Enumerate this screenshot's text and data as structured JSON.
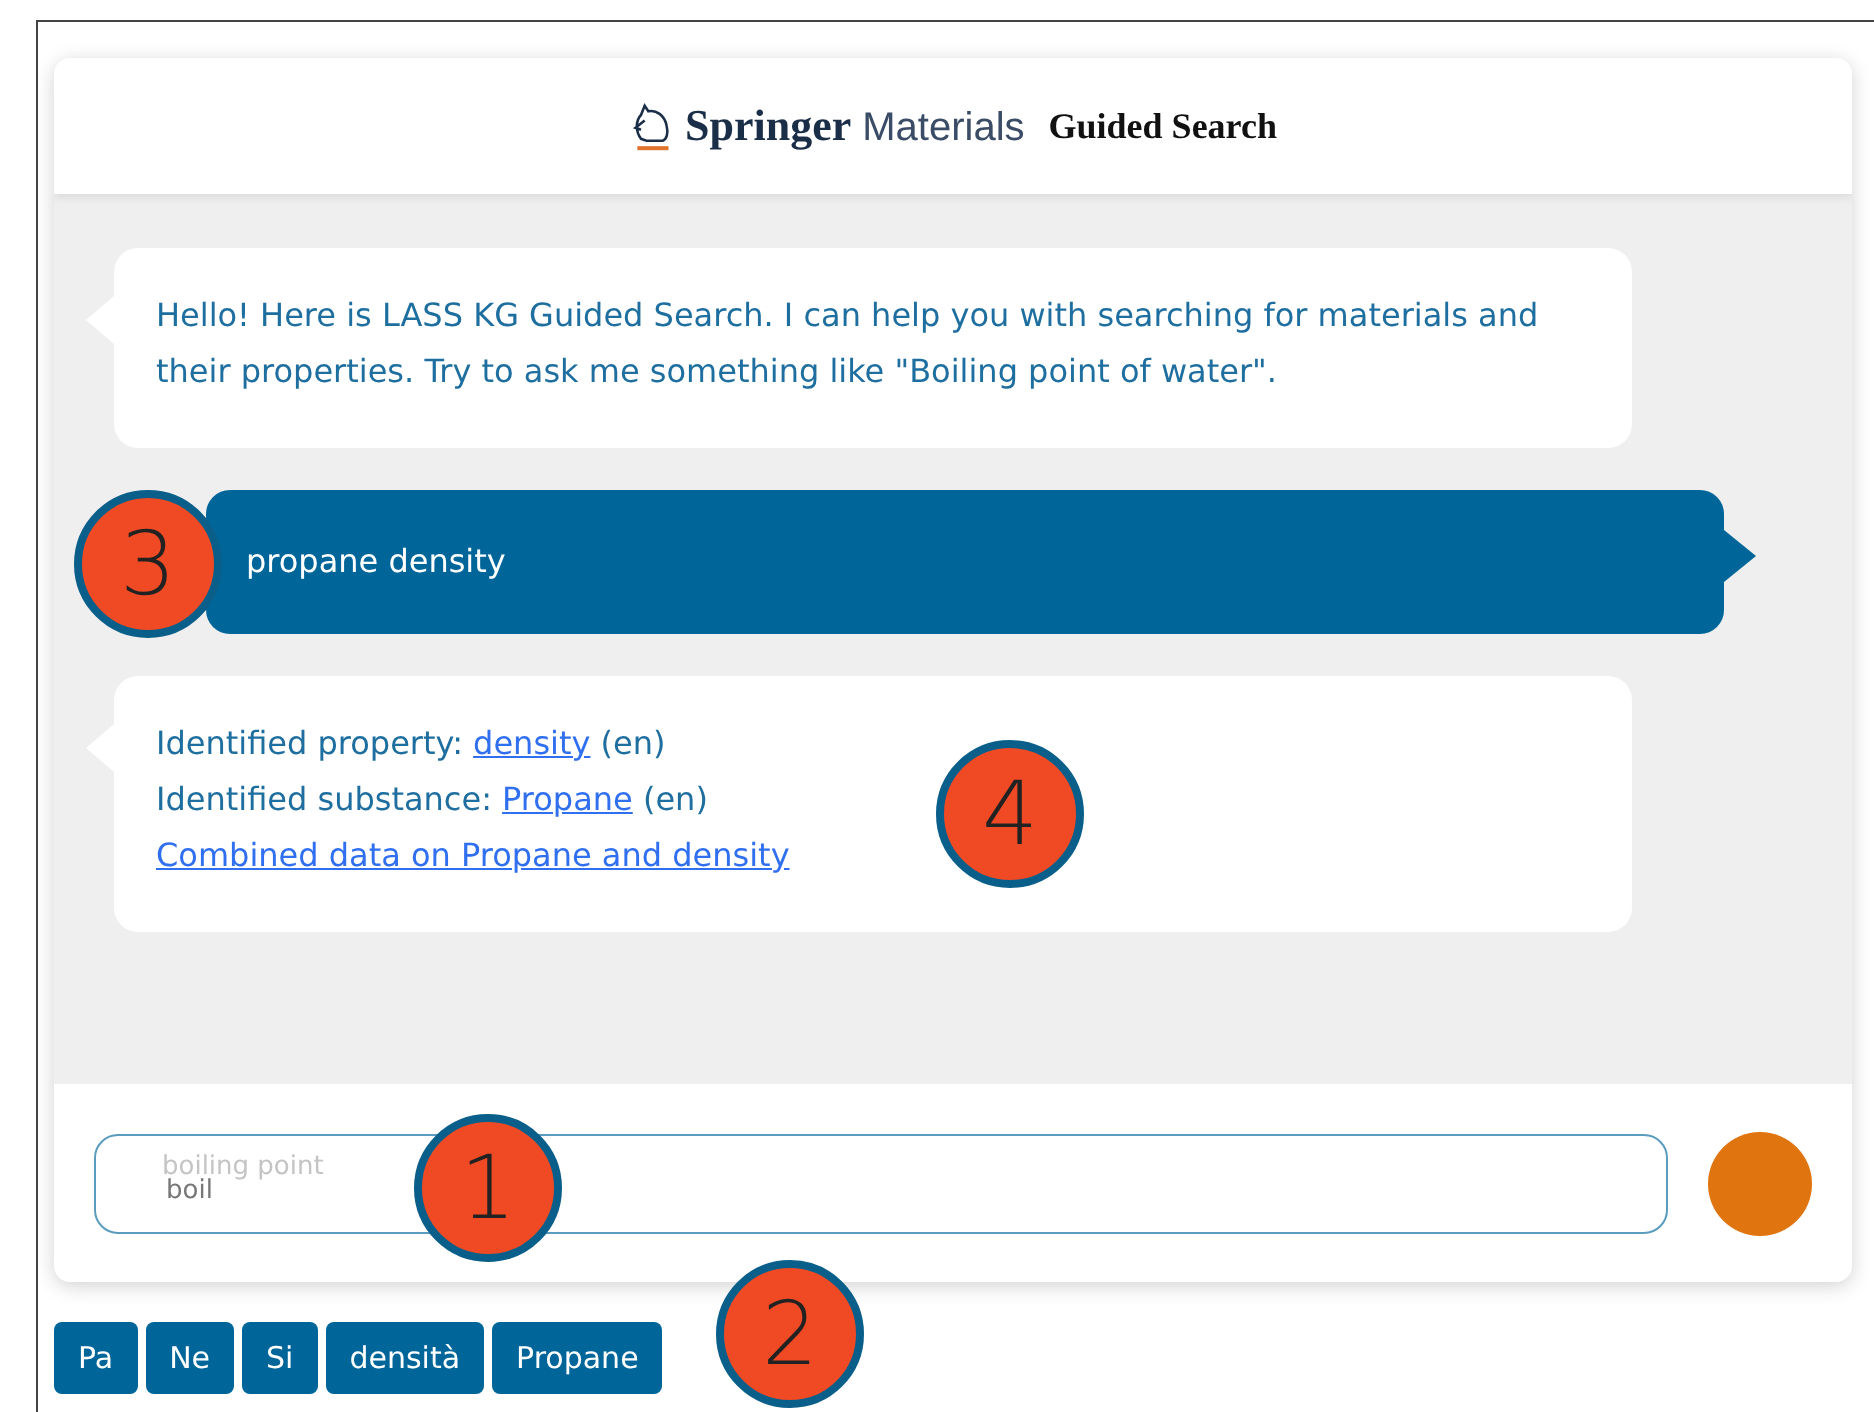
{
  "header": {
    "brand_bold": "Springer",
    "brand_light": "Materials",
    "title": "Guided Search"
  },
  "messages": [
    {
      "kind": "bot",
      "lines": [
        [
          {
            "kind": "text",
            "text": "Hello! Here is LASS KG Guided Search. I can help you with searching for materials and their properties. Try to ask me something like \"Boiling point of water\"."
          }
        ]
      ]
    },
    {
      "kind": "user",
      "lines": [
        [
          {
            "kind": "text",
            "text": "propane density"
          }
        ]
      ]
    },
    {
      "kind": "bot",
      "lines": [
        [
          {
            "kind": "text",
            "text": "Identified property: "
          },
          {
            "kind": "link",
            "text": "density"
          },
          {
            "kind": "text",
            "text": " (en)"
          }
        ],
        [
          {
            "kind": "text",
            "text": "Identified substance: "
          },
          {
            "kind": "link",
            "text": "Propane"
          },
          {
            "kind": "text",
            "text": " (en)"
          }
        ],
        [
          {
            "kind": "link",
            "text": "Combined data on Propane and density"
          }
        ]
      ]
    }
  ],
  "input": {
    "value": "boil",
    "suggestion": "boiling point"
  },
  "chips": [
    "Pa",
    "Ne",
    "Si",
    "densità",
    "Propane"
  ],
  "callouts": [
    "3",
    "4",
    "1",
    "2"
  ]
}
